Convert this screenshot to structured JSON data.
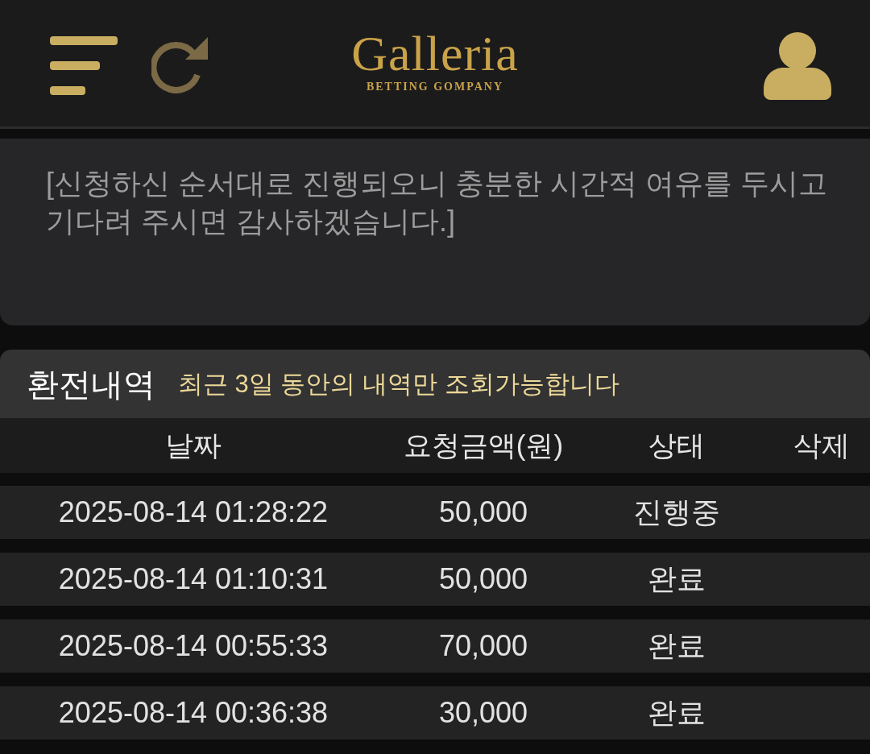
{
  "header": {
    "logo": {
      "title": "Galleria",
      "subtitle": "BETTING GOMPANY"
    }
  },
  "notice": {
    "text": "[신청하신 순서대로 진행되오니 충분한 시간적 여유를 두시고 기다려 주시면 감사하겠습니다.]"
  },
  "history": {
    "title": "환전내역",
    "note": "최근 3일 동안의 내역만 조회가능합니다",
    "columns": [
      "날짜",
      "요청금액(원)",
      "상태",
      "삭제"
    ],
    "rows": [
      {
        "date": "2025-08-14 01:28:22",
        "amount": "50,000",
        "status": "진행중"
      },
      {
        "date": "2025-08-14 01:10:31",
        "amount": "50,000",
        "status": "완료"
      },
      {
        "date": "2025-08-14 00:55:33",
        "amount": "70,000",
        "status": "완료"
      },
      {
        "date": "2025-08-14 00:36:38",
        "amount": "30,000",
        "status": "완료"
      }
    ]
  }
}
